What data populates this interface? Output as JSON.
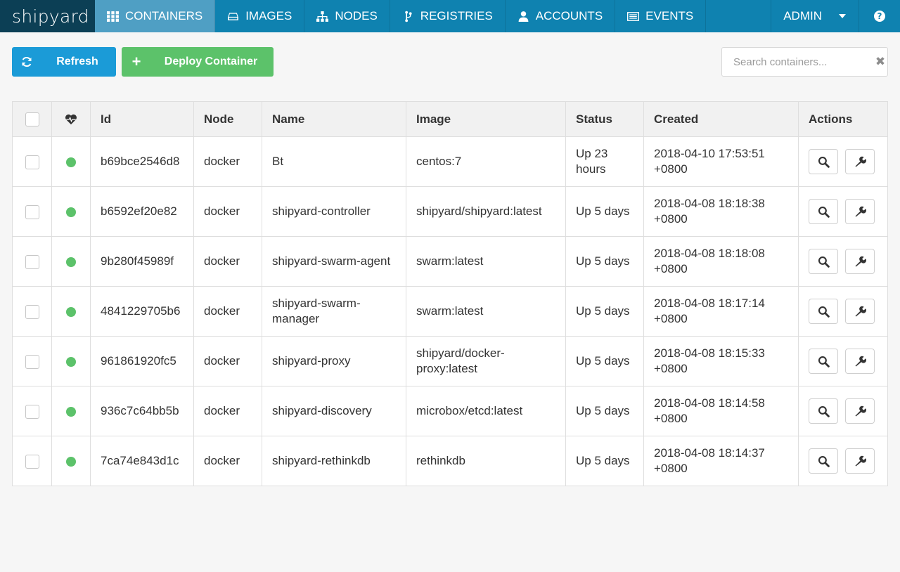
{
  "brand": "shipyard",
  "nav": {
    "items": [
      {
        "label": "CONTAINERS",
        "icon": "grid-icon"
      },
      {
        "label": "IMAGES",
        "icon": "hdd-icon"
      },
      {
        "label": "NODES",
        "icon": "sitemap-icon"
      },
      {
        "label": "REGISTRIES",
        "icon": "branch-icon"
      },
      {
        "label": "ACCOUNTS",
        "icon": "user-icon"
      },
      {
        "label": "EVENTS",
        "icon": "list-icon"
      }
    ],
    "active": "CONTAINERS",
    "user": "ADMIN",
    "help": "?"
  },
  "toolbar": {
    "refresh_label": "Refresh",
    "deploy_label": "Deploy Container",
    "deploy_icon": "+",
    "search_placeholder": "Search containers...",
    "clear_icon": "✖"
  },
  "colors": {
    "nav_bg": "#0f82b0",
    "brand_bg": "#0c3f55",
    "nav_active": "#4f9fc4",
    "refresh": "#1b9bd7",
    "deploy": "#5cc26a",
    "status_running": "#5cc26a"
  },
  "table": {
    "headers": [
      "",
      "heart-icon",
      "Id",
      "Node",
      "Name",
      "Image",
      "Status",
      "Created",
      "Actions"
    ],
    "header_labels": {
      "id": "Id",
      "node": "Node",
      "name": "Name",
      "image": "Image",
      "status": "Status",
      "created": "Created",
      "actions": "Actions"
    },
    "rows": [
      {
        "id": "b69bce2546d8",
        "node": "docker",
        "name": "Bt",
        "image": "centos:7",
        "status": "Up 23 hours",
        "created": "2018-04-10 17:53:51 +0800"
      },
      {
        "id": "b6592ef20e82",
        "node": "docker",
        "name": "shipyard-controller",
        "image": "shipyard/shipyard:latest",
        "status": "Up 5 days",
        "created": "2018-04-08 18:18:38 +0800"
      },
      {
        "id": "9b280f45989f",
        "node": "docker",
        "name": "shipyard-swarm-agent",
        "image": "swarm:latest",
        "status": "Up 5 days",
        "created": "2018-04-08 18:18:08 +0800"
      },
      {
        "id": "4841229705b6",
        "node": "docker",
        "name": "shipyard-swarm-manager",
        "image": "swarm:latest",
        "status": "Up 5 days",
        "created": "2018-04-08 18:17:14 +0800"
      },
      {
        "id": "961861920fc5",
        "node": "docker",
        "name": "shipyard-proxy",
        "image": "shipyard/docker-proxy:latest",
        "status": "Up 5 days",
        "created": "2018-04-08 18:15:33 +0800"
      },
      {
        "id": "936c7c64bb5b",
        "node": "docker",
        "name": "shipyard-discovery",
        "image": "microbox/etcd:latest",
        "status": "Up 5 days",
        "created": "2018-04-08 18:14:58 +0800"
      },
      {
        "id": "7ca74e843d1c",
        "node": "docker",
        "name": "shipyard-rethinkdb",
        "image": "rethinkdb",
        "status": "Up 5 days",
        "created": "2018-04-08 18:14:37 +0800"
      }
    ]
  }
}
